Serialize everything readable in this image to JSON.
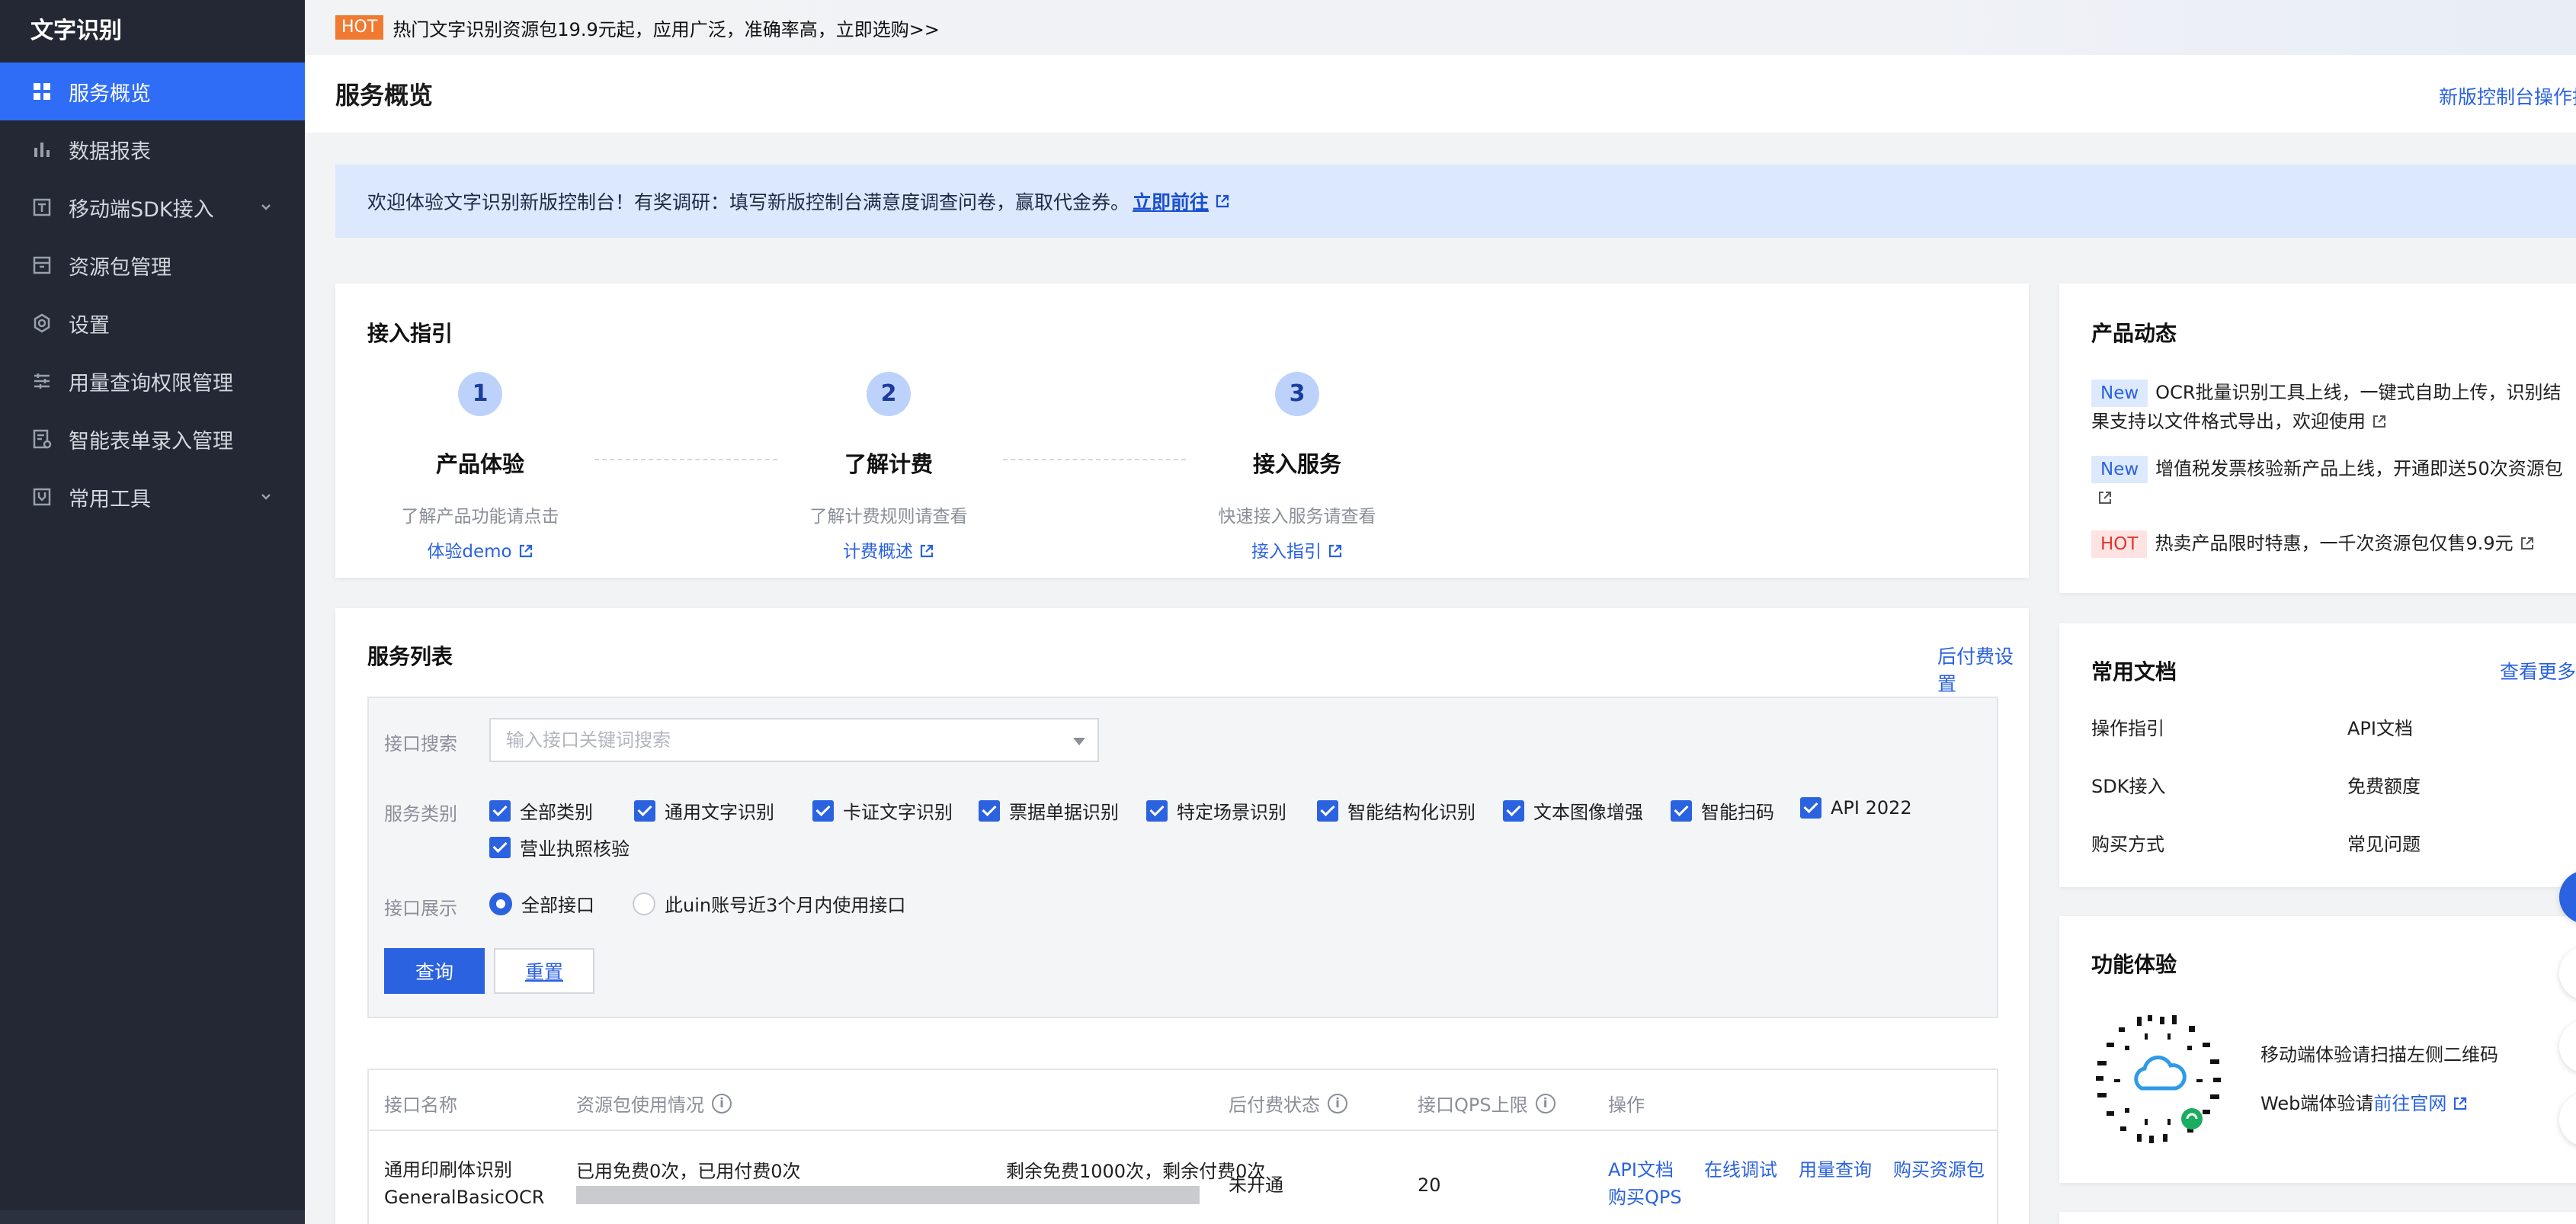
{
  "sidebar": {
    "title": "文字识别",
    "items": [
      {
        "label": "服务概览",
        "icon": "grid-icon",
        "active": true
      },
      {
        "label": "数据报表",
        "icon": "bar-chart-icon"
      },
      {
        "label": "移动端SDK接入",
        "icon": "sdk-icon",
        "expandable": true
      },
      {
        "label": "资源包管理",
        "icon": "package-icon"
      },
      {
        "label": "设置",
        "icon": "gear-icon"
      },
      {
        "label": "用量查询权限管理",
        "icon": "list-icon"
      },
      {
        "label": "智能表单录入管理",
        "icon": "form-icon"
      },
      {
        "label": "常用工具",
        "icon": "tool-icon",
        "expandable": true
      }
    ]
  },
  "banner": {
    "hot_tag": "HOT",
    "text": "热门文字识别资源包19.9元起，应用广泛，准确率高，立即选购>>"
  },
  "header": {
    "title": "服务概览",
    "right_link": "新版控制台操作指"
  },
  "notice": {
    "text": "欢迎体验文字识别新版控制台！有奖调研：填写新版控制台满意度调查问卷，赢取代金券。",
    "link": "立即前往"
  },
  "guide": {
    "title": "接入指引",
    "steps": [
      {
        "num": "1",
        "name": "产品体验",
        "desc": "了解产品功能请点击",
        "link": "体验demo"
      },
      {
        "num": "2",
        "name": "了解计费",
        "desc": "了解计费规则请查看",
        "link": "计费概述"
      },
      {
        "num": "3",
        "name": "接入服务",
        "desc": "快速接入服务请查看",
        "link": "接入指引"
      }
    ]
  },
  "news": {
    "title": "产品动态",
    "items": [
      {
        "tag": "New",
        "text": "OCR批量识别工具上线，一键式自助上传，识别结果支持以文件格式导出，欢迎使用"
      },
      {
        "tag": "New",
        "text": "增值税发票核验新产品上线，开通即送50次资源包"
      },
      {
        "tag": "HOT",
        "text": "热卖产品限时特惠，一千次资源包仅售9.9元"
      }
    ]
  },
  "service_list": {
    "title": "服务列表",
    "postpay_link": "后付费设置",
    "filter": {
      "search_label": "接口搜索",
      "search_placeholder": "输入接口关键词搜索",
      "category_label": "服务类别",
      "categories": [
        "全部类别",
        "通用文字识别",
        "卡证文字识别",
        "票据单据识别",
        "特定场景识别",
        "智能结构化识别",
        "文本图像增强",
        "智能扫码",
        "API 2022",
        "营业执照核验"
      ],
      "display_label": "接口展示",
      "display_options": [
        "全部接口",
        "此uin账号近3个月内使用接口"
      ],
      "query_button": "查询",
      "reset_button": "重置"
    },
    "table": {
      "headers": [
        "接口名称",
        "资源包使用情况",
        "后付费状态",
        "接口QPS上限",
        "操作"
      ],
      "rows": [
        {
          "name": "通用印刷体识别",
          "code": "GeneralBasicOCR",
          "usage_left": "已用免费0次，已用付费0次",
          "usage_right": "剩余免费1000次，剩余付费0次",
          "postpay": "未开通",
          "qps": "20",
          "actions": [
            "API文档",
            "在线调试",
            "用量查询",
            "购买资源包",
            "购买QPS"
          ]
        }
      ]
    }
  },
  "docs": {
    "title": "常用文档",
    "more": "查看更多",
    "items": [
      "操作指引",
      "API文档",
      "SDK接入",
      "免费额度",
      "购买方式",
      "常见问题"
    ]
  },
  "experience": {
    "title": "功能体验",
    "mobile_text": "移动端体验请扫描左侧二维码",
    "web_text": "Web端体验请",
    "web_link": "前往官网"
  },
  "colors": {
    "accent": "#2a62e0",
    "sidebar_bg": "#232834",
    "hot_orange": "#f07a32"
  }
}
